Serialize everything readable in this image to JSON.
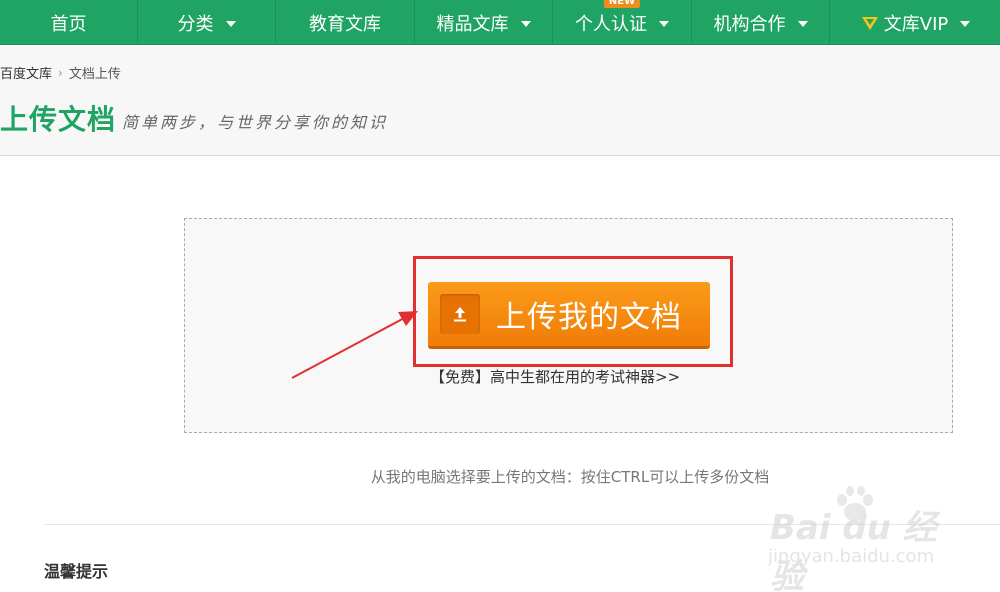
{
  "nav": {
    "items": [
      {
        "label": "首页",
        "has_caret": false
      },
      {
        "label": "分类",
        "has_caret": true
      },
      {
        "label": "教育文库",
        "has_caret": false
      },
      {
        "label": "精品文库",
        "has_caret": true
      },
      {
        "label": "个人认证",
        "has_caret": true,
        "badge": "NEW"
      },
      {
        "label": "机构合作",
        "has_caret": true
      },
      {
        "label": "文库VIP",
        "has_caret": true,
        "icon": "vip-icon"
      }
    ]
  },
  "breadcrumb": {
    "root": "百度文库",
    "current": "文档上传"
  },
  "header": {
    "title": "上传文档",
    "slogan": "简单两步，与世界分享你的知识"
  },
  "upload": {
    "button_label": "上传我的文档",
    "button_icon": "upload-arrow-icon",
    "promo": "【免费】高中生都在用的考试神器>>"
  },
  "tip": "从我的电脑选择要上传的文档：按住CTRL可以上传多份文档",
  "tips_heading": "温馨提示",
  "watermark": {
    "brand": "Bai du 经验",
    "url": "jingyan.baidu.com"
  },
  "colors": {
    "brand_green": "#20a464",
    "button_orange": "#f7890f",
    "highlight_red": "#e03030",
    "badge_orange": "#f08c1b"
  }
}
